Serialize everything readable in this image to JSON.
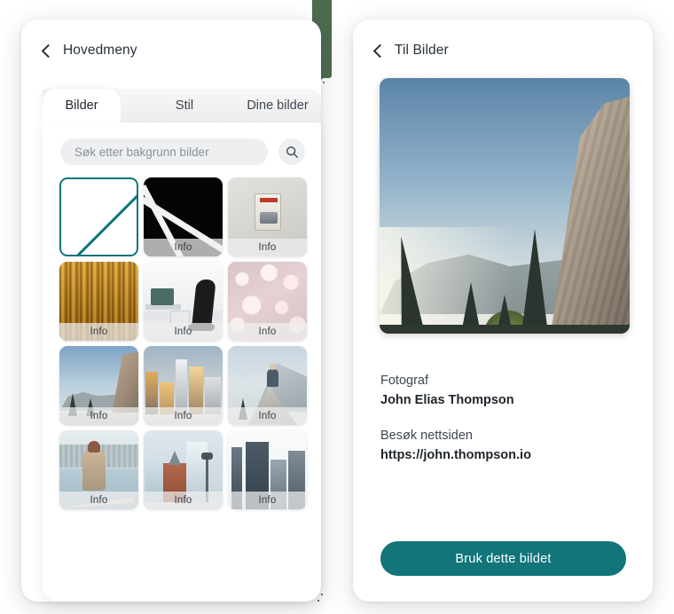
{
  "theme": {
    "accent": "#11757a",
    "text_dark": "#20262e",
    "text_muted": "#3d4550",
    "placeholder": "#8b9199",
    "panel_bg": "#ffffff",
    "search_bg": "#eeeff0"
  },
  "left_panel": {
    "back_label": "Hovedmeny",
    "back_icon": "chevron-left-icon",
    "tabs": [
      {
        "label": "Bilder",
        "active": true
      },
      {
        "label": "Stil",
        "active": false
      },
      {
        "label": "Dine bilder",
        "active": false
      }
    ],
    "search": {
      "placeholder": "Søk etter bakgrunn bilder",
      "value": "",
      "button_icon": "search-icon"
    },
    "grid": {
      "info_label": "Info",
      "tiles": [
        {
          "name": "no-image-placeholder",
          "art": "placeholder",
          "has_info": false
        },
        {
          "name": "black-abstract-lines",
          "art": "art-black",
          "has_info": true
        },
        {
          "name": "fire-alarm-switch",
          "art": "art-switch",
          "has_info": true
        },
        {
          "name": "golden-wood-texture",
          "art": "art-wood",
          "has_info": true
        },
        {
          "name": "office-interior",
          "art": "art-office",
          "has_info": true
        },
        {
          "name": "pink-bokeh-lights",
          "art": "art-bokeh",
          "has_info": true
        },
        {
          "name": "yosemite-valley",
          "art": "art-yos",
          "has_info": true
        },
        {
          "name": "city-skyline-sunset",
          "art": "art-city",
          "has_info": true
        },
        {
          "name": "hiker-on-peak",
          "art": "art-peak",
          "has_info": true
        },
        {
          "name": "woman-in-canoe",
          "art": "art-canoe",
          "has_info": true
        },
        {
          "name": "flatiron-building",
          "art": "art-flat",
          "has_info": true
        },
        {
          "name": "modern-skyscrapers",
          "art": "art-towers",
          "has_info": true
        }
      ]
    }
  },
  "right_panel": {
    "back_label": "Til Bilder",
    "back_icon": "chevron-left-icon",
    "preview_image_name": "el-capitan-yosemite-photo",
    "photographer_label": "Fotograf",
    "photographer_name": "John Elias Thompson",
    "website_label": "Besøk nettsiden",
    "website_url": "https://john.thompson.io",
    "use_button_label": "Bruk dette bildet"
  }
}
